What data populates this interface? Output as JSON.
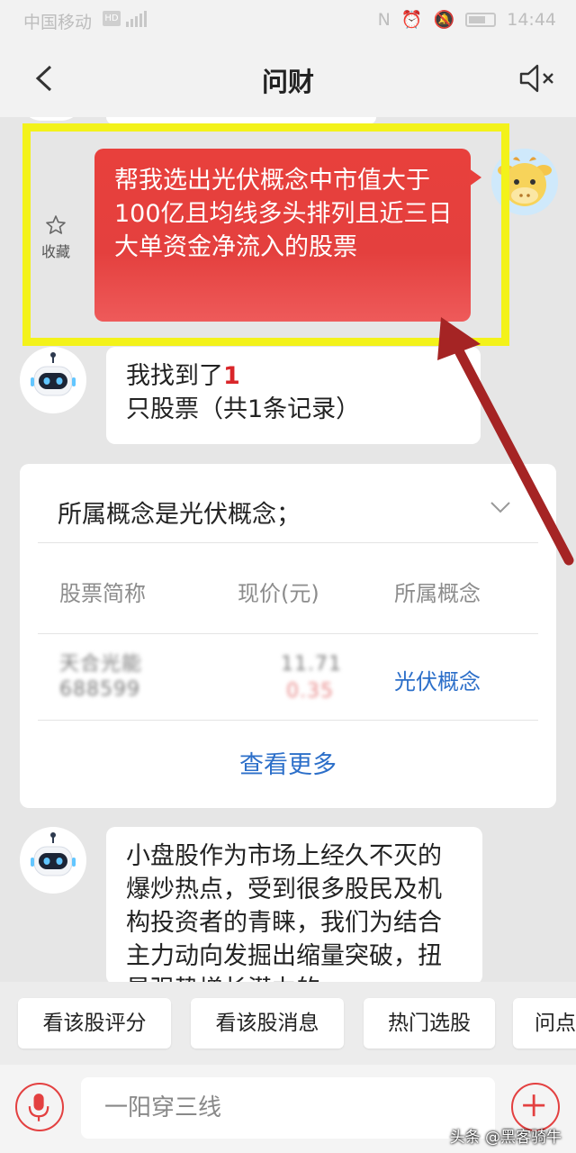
{
  "status_bar": {
    "carrier": "中国移动",
    "hd": "HD",
    "time": "14:44"
  },
  "header": {
    "title": "问财"
  },
  "collect": {
    "label": "收藏"
  },
  "user_message": {
    "text": "帮我选出光伏概念中市值大于100亿且均线多头排列且近三日大单资金净流入的股票"
  },
  "bot_reply_1": {
    "prefix": "我找到了",
    "count": "1",
    "suffix": "只股票（共1条记录）"
  },
  "result_card": {
    "condition": "所属概念是光伏概念；",
    "headers": [
      "股票简称",
      "现价(元)",
      "所属概念"
    ],
    "row": {
      "name": "天合光能",
      "code": "688599",
      "price": "11.71",
      "change": "0.35",
      "concept": "光伏概念"
    },
    "more_label": "查看更多"
  },
  "bot_reply_2": {
    "text": "小盘股作为市场上经久不灭的爆炒热点，受到很多股民及机构投资者的青睐，我们为结合主力动向发掘出缩量突破，扭旱强势增长潜力的"
  },
  "quick_actions": [
    "看该股评分",
    "看该股消息",
    "热门选股",
    "问点"
  ],
  "input": {
    "placeholder": "一阳穿三线"
  },
  "watermark": "头条 @黑客骑牛",
  "colors": {
    "accent_red": "#e8403c",
    "link_blue": "#2c6fc9",
    "highlight_yellow": "#f3f21a",
    "arrow_red": "#a52424"
  }
}
